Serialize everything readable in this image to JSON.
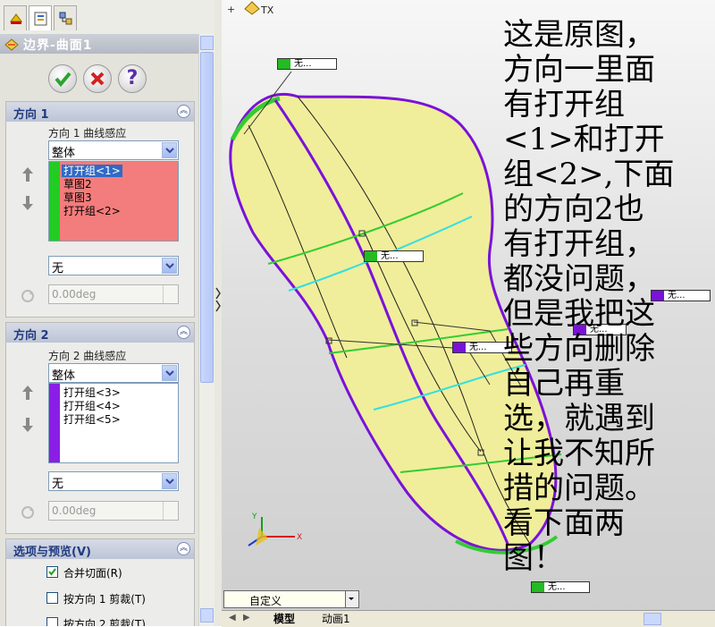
{
  "property_manager": {
    "tabs": [
      {
        "name": "feature-manager",
        "icon": "feature-tree-icon"
      },
      {
        "name": "property-manager",
        "icon": "property-manager-icon"
      },
      {
        "name": "configuration-manager",
        "icon": "configuration-icon"
      }
    ],
    "title": "边界-曲面1",
    "ok_icon": "checkmark-icon",
    "cancel_icon": "cross-icon",
    "help_label": "?",
    "direction1": {
      "header": "方向 1",
      "curve_influence_label": "方向 1 曲线感应",
      "influence_value": "整体",
      "items": [
        "打开组<1>",
        "草图2",
        "草图3",
        "打开组<2>"
      ],
      "selected_index": 0,
      "tangent_value": "无",
      "angle_value": "0.00deg"
    },
    "direction2": {
      "header": "方向 2",
      "curve_influence_label": "方向 2 曲线感应",
      "influence_value": "整体",
      "items": [
        "打开组<3>",
        "打开组<4>",
        "打开组<5>"
      ],
      "tangent_value": "无",
      "angle_value": "0.00deg"
    },
    "options": {
      "header": "选项与预览(V)",
      "merge_tangent": "合并切面(R)",
      "merge_tangent_checked": true,
      "trim_dir1": "按方向 1 剪裁(T)",
      "trim_dir1_checked": false,
      "trim_dir2": "按方向 2 剪裁(T)",
      "trim_dir2_checked": false
    }
  },
  "viewport": {
    "corner_label": "TX",
    "callout_text": "无...",
    "comment_lines": [
      "这是原图，",
      "方向一里面",
      "有打开组",
      "<1>和打开",
      "组<2>,下面",
      "的方向2也",
      "有打开组，",
      "都没问题，",
      "但是我把这",
      "些方向删除",
      "自己再重",
      "选，就遇到",
      "让我不知所",
      "措的问题。",
      "看下面两",
      "图！"
    ],
    "colors": {
      "surface": "#f0ee9a",
      "direction1_curve": "#7a12d9",
      "green_curve": "#33cc33",
      "cyan_curve": "#33e0e0"
    }
  },
  "bottom_bar": {
    "view_combo": "自定义",
    "tabs": [
      "模型",
      "动画1"
    ]
  }
}
